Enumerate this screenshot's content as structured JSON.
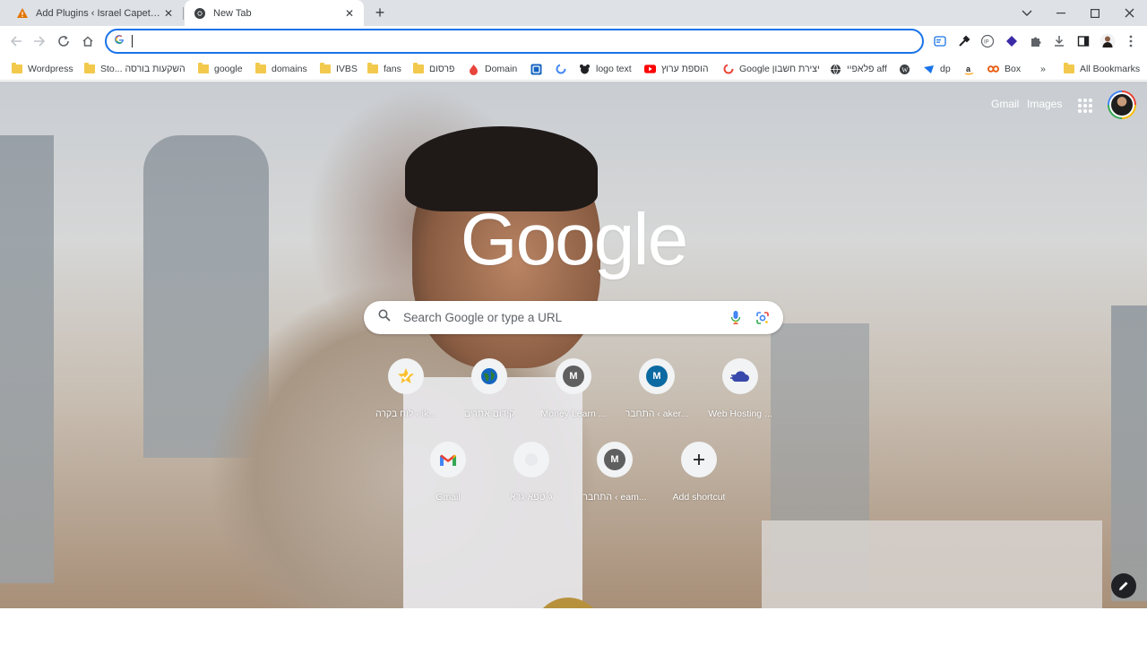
{
  "tabs": [
    {
      "title": "Add Plugins ‹ Israel Capetillo —",
      "active": false,
      "icon": "wordpress-warning-icon"
    },
    {
      "title": "New Tab",
      "active": true,
      "icon": "chrome-icon"
    }
  ],
  "toolbar": {
    "omnibox_value": "",
    "omnibox_icon": "google-g-icon"
  },
  "bookmarks": [
    {
      "label": "Wordpress",
      "icon": "folder-icon"
    },
    {
      "label": "Sto... השקעות בורסה",
      "icon": "folder-icon"
    },
    {
      "label": "google",
      "icon": "folder-icon"
    },
    {
      "label": "domains",
      "icon": "folder-icon"
    },
    {
      "label": "IVBS",
      "icon": "folder-icon"
    },
    {
      "label": "fans",
      "icon": "folder-icon"
    },
    {
      "label": "פרסום",
      "icon": "folder-icon"
    },
    {
      "label": "Domain",
      "icon": "flame-icon"
    },
    {
      "label": "",
      "icon": "blue-square-icon"
    },
    {
      "label": "",
      "icon": "google-g-icon"
    },
    {
      "label": "logo text",
      "icon": "mascot-icon"
    },
    {
      "label": "הוספת ערוץ",
      "icon": "youtube-icon"
    },
    {
      "label": "Google יצירת חשבון",
      "icon": "google-g-icon"
    },
    {
      "label": "פלאפיי aff",
      "icon": "globe-icon"
    },
    {
      "label": "",
      "icon": "wordpress-icon"
    },
    {
      "label": "dp",
      "icon": "dp-icon"
    },
    {
      "label": "",
      "icon": "amazon-icon"
    },
    {
      "label": "Box",
      "icon": "box-icon"
    },
    {
      "label": "»",
      "icon": ""
    },
    {
      "label": "All Bookmarks",
      "icon": "folder-icon"
    }
  ],
  "ntp": {
    "gmail_link": "Gmail",
    "images_link": "Images",
    "logo": "Google",
    "search_placeholder": "Search Google or type a URL",
    "shortcuts_row1": [
      {
        "label": "לוח בקרה ‹ ik...",
        "icon": "check-star-icon"
      },
      {
        "label": "קידום אתרים",
        "icon": "globe-icon"
      },
      {
        "label": "Money Learn ...",
        "letter": "M",
        "color": "#5f5f5f"
      },
      {
        "label": "התחבר ‹ aker...",
        "letter": "M",
        "color": "#0b6aa1"
      },
      {
        "label": "Web Hosting ...",
        "icon": "cloud-icon"
      }
    ],
    "shortcuts_row2": [
      {
        "label": "Gmail",
        "icon": "gmail-icon"
      },
      {
        "label": "טפא גרא‎ג׳",
        "icon": "blank-icon"
      },
      {
        "label": "התחבר ‹ eam...",
        "letter": "M",
        "color": "#5f5f5f"
      },
      {
        "label": "Add shortcut",
        "icon": "plus-icon"
      }
    ]
  },
  "colors": {
    "accent": "#1a73e8",
    "tabstrip": "#dee1e6"
  }
}
